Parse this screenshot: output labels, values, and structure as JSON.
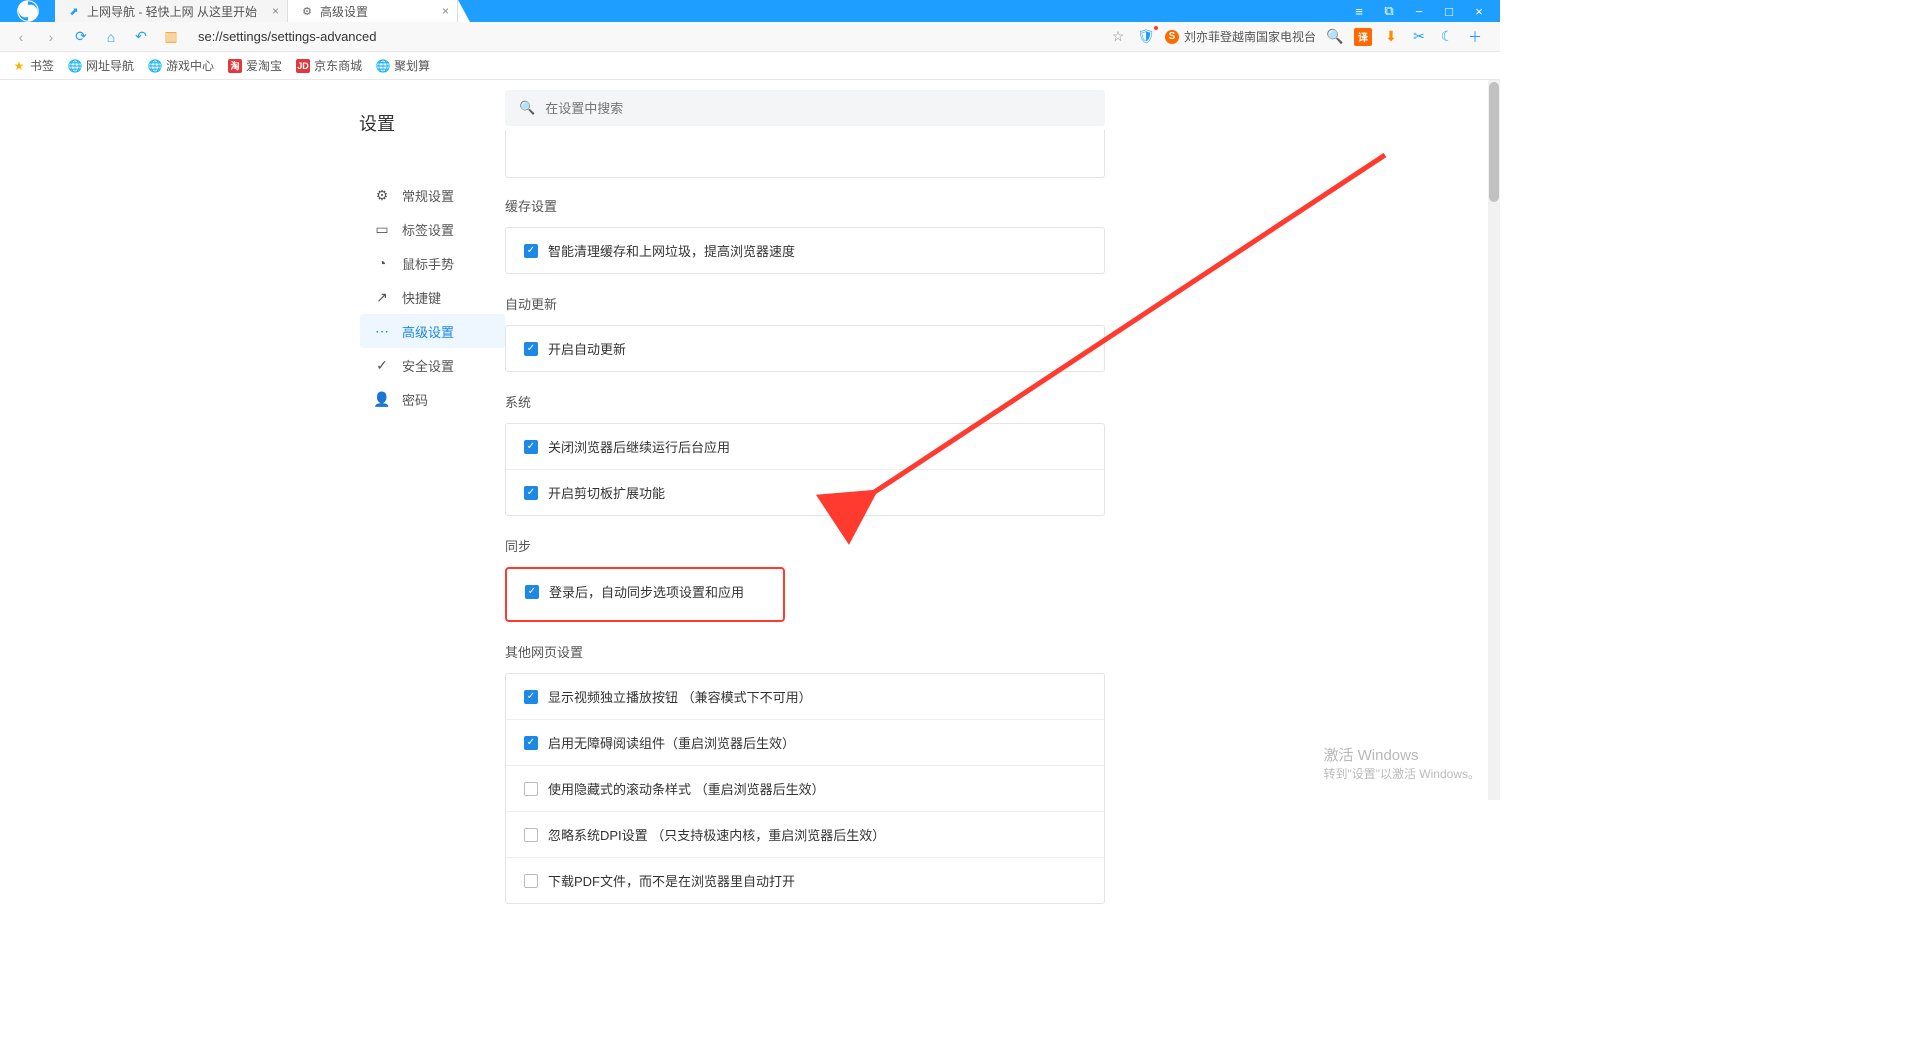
{
  "tabs": [
    {
      "title": "上网导航 - 轻快上网 从这里开始",
      "active": false,
      "fav": "↗"
    },
    {
      "title": "高级设置",
      "active": true,
      "fav": "⚙"
    }
  ],
  "window_controls": [
    "≡",
    "⧉",
    "−",
    "□",
    "×"
  ],
  "navbar": {
    "url": "se://settings/settings-advanced",
    "news": "刘亦菲登越南国家电视台"
  },
  "bookmarks": [
    {
      "label": "书签",
      "icon": "star"
    },
    {
      "label": "网址导航",
      "icon": "globe"
    },
    {
      "label": "游戏中心",
      "icon": "globe"
    },
    {
      "label": "爱淘宝",
      "icon": "red",
      "badge": "淘"
    },
    {
      "label": "京东商城",
      "icon": "red",
      "badge": "JD"
    },
    {
      "label": "聚划算",
      "icon": "globe"
    }
  ],
  "page_title": "设置",
  "nav_items": [
    {
      "id": "general",
      "label": "常规设置",
      "icon": "⚙",
      "active": false
    },
    {
      "id": "tabs",
      "label": "标签设置",
      "icon": "▭",
      "active": false
    },
    {
      "id": "gesture",
      "label": "鼠标手势",
      "icon": "◔",
      "active": false
    },
    {
      "id": "shortcut",
      "label": "快捷键",
      "icon": "↗",
      "active": false
    },
    {
      "id": "advanced",
      "label": "高级设置",
      "icon": "⋯",
      "active": true
    },
    {
      "id": "security",
      "label": "安全设置",
      "icon": "✓",
      "active": false
    },
    {
      "id": "password",
      "label": "密码",
      "icon": "👤",
      "active": false
    }
  ],
  "search_placeholder": "在设置中搜索",
  "sections": {
    "cache": {
      "title": "缓存设置",
      "items": [
        {
          "label": "智能清理缓存和上网垃圾，提高浏览器速度",
          "checked": true
        }
      ]
    },
    "update": {
      "title": "自动更新",
      "items": [
        {
          "label": "开启自动更新",
          "checked": true
        }
      ]
    },
    "system": {
      "title": "系统",
      "items": [
        {
          "label": "关闭浏览器后继续运行后台应用",
          "checked": true
        },
        {
          "label": "开启剪切板扩展功能",
          "checked": true
        }
      ]
    },
    "sync": {
      "title": "同步",
      "items": [
        {
          "label": "登录后，自动同步选项设置和应用",
          "checked": true
        }
      ]
    },
    "webpage": {
      "title": "其他网页设置",
      "items": [
        {
          "label": "显示视频独立播放按钮 （兼容模式下不可用）",
          "checked": true
        },
        {
          "label": "启用无障碍阅读组件（重启浏览器后生效）",
          "checked": true
        },
        {
          "label": "使用隐藏式的滚动条样式 （重启浏览器后生效）",
          "checked": false
        },
        {
          "label": "忽略系统DPI设置 （只支持极速内核，重启浏览器后生效）",
          "checked": false
        },
        {
          "label": "下载PDF文件，而不是在浏览器里自动打开",
          "checked": false
        }
      ]
    }
  },
  "watermark": {
    "t": "激活 Windows",
    "s": "转到\"设置\"以激活 Windows。"
  }
}
